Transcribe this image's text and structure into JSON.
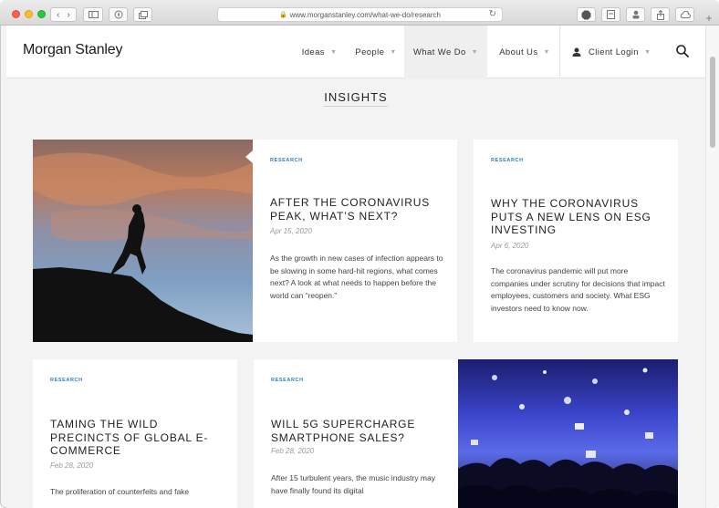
{
  "browser": {
    "url": "www.morganstanley.com/what-we-do/research",
    "colors": {
      "close": "#fc5f57",
      "minimize": "#fdbc2e",
      "maximize": "#29c840"
    }
  },
  "header": {
    "logo": "Morgan Stanley",
    "nav": [
      {
        "label": "Ideas",
        "active": false
      },
      {
        "label": "People",
        "active": false
      },
      {
        "label": "What We Do",
        "active": true
      },
      {
        "label": "About Us",
        "active": false
      }
    ],
    "client_login": "Client Login"
  },
  "page": {
    "section_title": "INSIGHTS"
  },
  "articles": [
    {
      "tag": "RESEARCH",
      "title": "AFTER THE CORONAVIRUS PEAK, WHAT’S NEXT?",
      "date": "Apr 15, 2020",
      "body": "As the growth in new cases of infection appears to be slowing in some hard-hit regions, what comes next? A look at what needs to happen before the world can “reopen.”"
    },
    {
      "tag": "RESEARCH",
      "title": "WHY THE CORONAVIRUS PUTS A NEW LENS ON ESG INVESTING",
      "date": "Apr 6, 2020",
      "body": "The coronavirus pandemic will put more companies under scrutiny for decisions that impact employees, customers and society. What ESG investors need to know now."
    },
    {
      "tag": "RESEARCH",
      "title": "TAMING THE WILD PRECINCTS OF GLOBAL E-COMMERCE",
      "date": "Feb 28, 2020",
      "body": "The proliferation of counterfeits and fake"
    },
    {
      "tag": "RESEARCH",
      "title": "WILL 5G SUPERCHARGE SMARTPHONE SALES?",
      "date": "Feb 28, 2020",
      "body": "After 15 turbulent years, the music industry may have finally found its digital"
    }
  ],
  "colors": {
    "accent": "#2f7fbf",
    "text": "#1f1f1f",
    "background": "#f3f3f3"
  }
}
